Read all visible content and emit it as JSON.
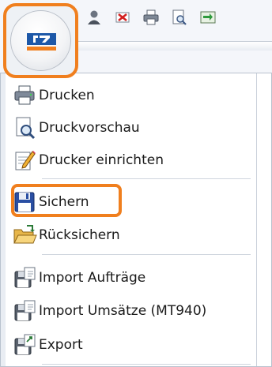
{
  "app_button": {
    "logo_icon": "volksbank-logo-icon",
    "colors": {
      "brand_blue": "#1d58a8",
      "brand_orange": "#f07f1e"
    }
  },
  "quick_toolbar": {
    "icons": [
      "user-icon",
      "delete-icon",
      "print-icon",
      "print-preview-icon",
      "transfer-icon"
    ]
  },
  "menu": {
    "items": [
      {
        "label": "Drucken",
        "icon": "printer-icon"
      },
      {
        "label": "Druckvorschau",
        "icon": "print-preview-icon"
      },
      {
        "label": "Drucker einrichten",
        "icon": "printer-setup-icon"
      },
      {
        "label": "Sichern",
        "icon": "save-disk-icon"
      },
      {
        "label": "Rücksichern",
        "icon": "open-folder-icon"
      },
      {
        "label": "Import Aufträge",
        "icon": "import-icon"
      },
      {
        "label": "Import Umsätze (MT940)",
        "icon": "import-icon"
      },
      {
        "label": "Export",
        "icon": "export-icon"
      }
    ]
  },
  "highlight_color": "#f07f1e"
}
